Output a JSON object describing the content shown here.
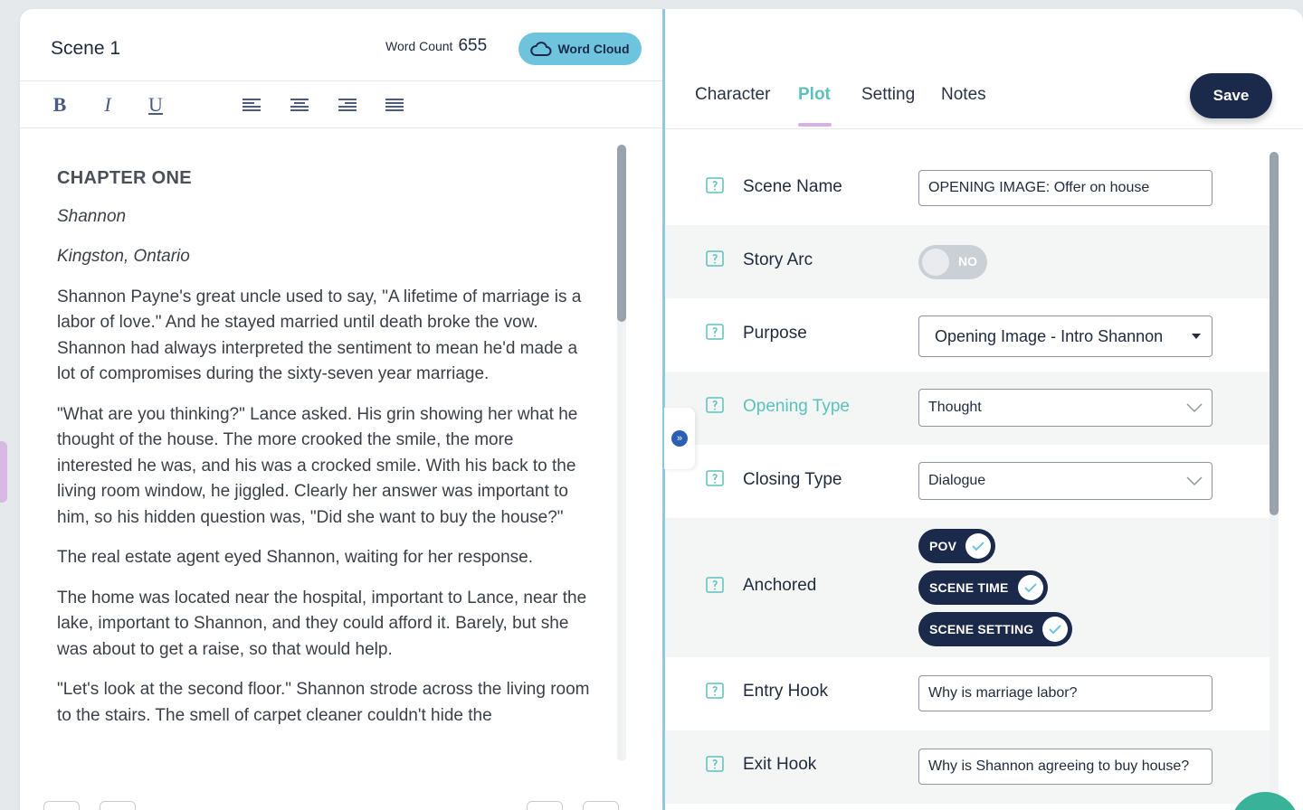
{
  "editor": {
    "scene_title": "Scene 1",
    "word_count_label": "Word Count",
    "word_count_value": "655",
    "word_cloud_label": "Word Cloud",
    "toolbar": {
      "bold": "B",
      "italic": "I",
      "underline": "U"
    },
    "content": {
      "chapter_heading": "CHAPTER ONE",
      "pov_line": "Shannon",
      "location_line": "Kingston, Ontario",
      "paragraphs": [
        "Shannon Payne's great uncle used to say, \"A lifetime of marriage is a labor of love.\" And he stayed married until death broke the vow. Shannon had always interpreted the sentiment to mean he'd made a lot of compromises during the sixty-seven year marriage.",
        "\"What are you thinking?\" Lance asked. His grin showing her what he thought of the house. The more crooked the smile, the more interested he was, and his was a crocked smile. With his back to the living room window, he jiggled. Clearly her answer was important to him, so his hidden question was, \"Did she want to buy the house?\"",
        "The real estate agent eyed Shannon, waiting for her response.",
        "The home was located near the hospital, important to Lance, near the lake, important to Shannon, and they could afford it. Barely, but she was about to get a raise, so that would help.",
        "\"Let's look at the second floor.\" Shannon strode across the living room to the stairs. The smell of carpet cleaner couldn't hide the"
      ]
    }
  },
  "form": {
    "tabs": [
      {
        "label": "Character",
        "active": false
      },
      {
        "label": "Plot",
        "active": true
      },
      {
        "label": "Setting",
        "active": false
      },
      {
        "label": "Notes",
        "active": false
      }
    ],
    "save_label": "Save",
    "fields": {
      "scene_name": {
        "label": "Scene Name",
        "value": "OPENING IMAGE: Offer on house"
      },
      "story_arc": {
        "label": "Story Arc",
        "toggle_label": "NO",
        "on": false
      },
      "purpose": {
        "label": "Purpose",
        "value": "Opening Image - Intro Shannon"
      },
      "opening_type": {
        "label": "Opening Type",
        "value": "Thought"
      },
      "closing_type": {
        "label": "Closing Type",
        "value": "Dialogue"
      },
      "anchored": {
        "label": "Anchored",
        "pills": [
          "POV",
          "SCENE TIME",
          "SCENE SETTING"
        ]
      },
      "entry_hook": {
        "label": "Entry Hook",
        "value": "Why is marriage labor?"
      },
      "exit_hook": {
        "label": "Exit Hook",
        "value": "Why is Shannon agreeing to buy house?"
      }
    }
  },
  "colors": {
    "accent_teal": "#5cc1ba",
    "navy": "#1b2a4a",
    "word_cloud_blue": "#6fc4dd",
    "tab_underline": "#d7b2e0"
  }
}
